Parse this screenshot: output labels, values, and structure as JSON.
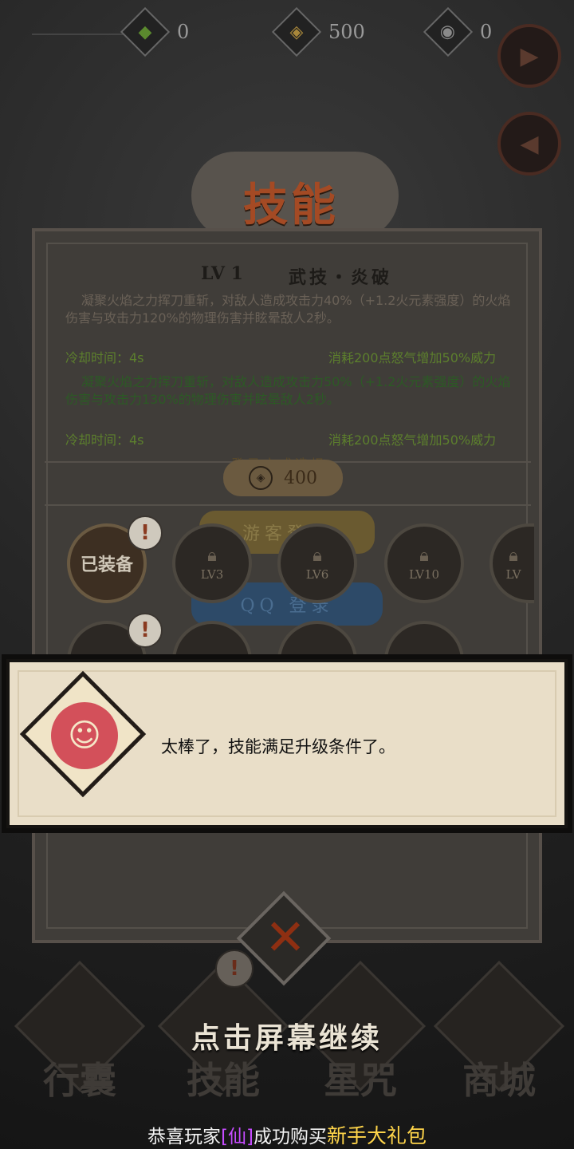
{
  "currencies": [
    {
      "icon": "green-flame-icon",
      "value": "0"
    },
    {
      "icon": "gold-coin-icon",
      "value": "500"
    },
    {
      "icon": "silver-swirl-icon",
      "value": "0"
    }
  ],
  "side_buttons": [
    {
      "icon": "video-play-icon"
    },
    {
      "icon": "megaphone-icon"
    }
  ],
  "panel": {
    "title": "技能",
    "level": "LV 1",
    "skill_name": "武技・炎破",
    "desc_current": "凝聚火焰之力挥刀重斩，对敌人造成攻击力40%（+1.2火元素强度）的火焰伤害与攻击力120%的物理伤害并眩晕敌人2秒。",
    "cooldown_1": "冷却时间：4s",
    "rage_1": "消耗200点怒气增加50%威力",
    "desc_next": "凝聚火焰之力挥刀重斩，对敌人造成攻击力50%（+1.2火元素强度）的火焰伤害与攻击力130%的物理伤害并眩晕敌人2秒。",
    "cooldown_2": "冷却时间：4s",
    "rage_2": "消耗200点怒气增加50%威力",
    "select_title": "登录方式选择",
    "upgrade_cost": "400",
    "guest_login": "游客登录",
    "qq_login": "QQ 登录"
  },
  "skills": [
    {
      "label": "已装备",
      "badge": "!"
    },
    {
      "label": "LV3"
    },
    {
      "label": "LV6"
    },
    {
      "label": "LV10"
    },
    {
      "label": "LV"
    }
  ],
  "dialog": {
    "speaker_icon": "red-monkey-portrait",
    "text": "太棒了，技能满足升级条件了。"
  },
  "close_label": "✕",
  "nav": [
    {
      "label": "行囊",
      "icon": "bag-icon"
    },
    {
      "label": "技能",
      "icon": "skill-icon",
      "badge": "!"
    },
    {
      "label": "星咒",
      "icon": "scroll-icon"
    },
    {
      "label": "商城",
      "icon": "shop-icon"
    }
  ],
  "continue_text": "点击屏幕继续",
  "announcement": {
    "prefix": "恭喜玩家",
    "player": "[仙]",
    "middle": "成功购买",
    "item": "新手大礼包"
  },
  "colors": {
    "title": "#a44a24",
    "accent_green": "#5c7f2d",
    "announce_name": "#c64cff",
    "announce_item": "#ffd54a"
  }
}
